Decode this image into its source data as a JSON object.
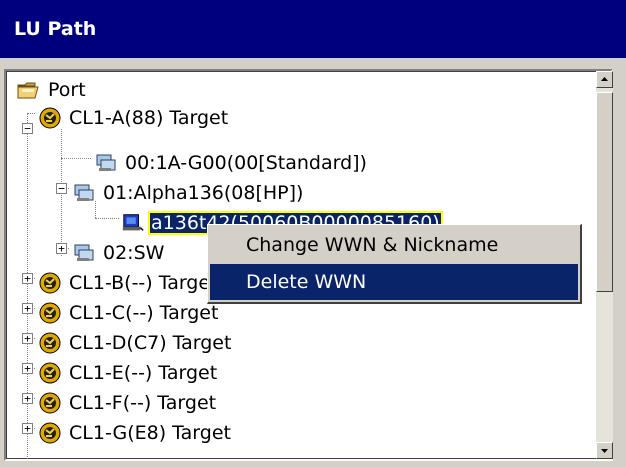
{
  "window": {
    "title": "LU Path"
  },
  "tree": {
    "root_label": "Port",
    "ports": [
      {
        "label": "CL1-A(88) Target",
        "expanded": true
      },
      {
        "label": "CL1-B(--) Target",
        "expanded": false
      },
      {
        "label": "CL1-C(--) Target",
        "expanded": false
      },
      {
        "label": "CL1-D(C7) Target",
        "expanded": false
      },
      {
        "label": "CL1-E(--) Target",
        "expanded": false
      },
      {
        "label": "CL1-F(--) Target",
        "expanded": false
      },
      {
        "label": "CL1-G(E8) Target",
        "expanded": false
      }
    ],
    "host_groups": [
      {
        "label": "00:1A-G00(00[Standard])",
        "expanded": null
      },
      {
        "label": "01:Alpha136(08[HP])",
        "expanded": true
      },
      {
        "label": "02:SW",
        "expanded": false
      }
    ],
    "wwn": {
      "label": "a136t42(50060B0000085160)",
      "selected": true
    }
  },
  "context_menu": {
    "items": [
      {
        "label": "Change WWN & Nickname",
        "highlighted": false
      },
      {
        "label": "Delete WWN",
        "highlighted": true
      }
    ]
  },
  "colors": {
    "title_bar": "#00007f",
    "selection": "#0a246a",
    "selection_outline": "#ffff00",
    "window_bg": "#d4d0c8"
  },
  "icons": {
    "root": "folder-icon",
    "port": "port-globe-icon",
    "host_group": "host-group-icon",
    "wwn": "hba-icon"
  }
}
